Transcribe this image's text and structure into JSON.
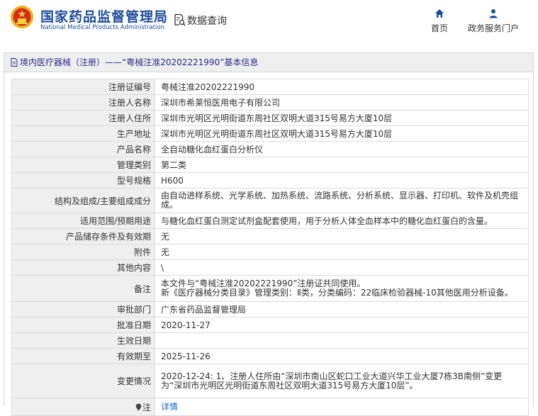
{
  "header": {
    "brand_cn": "国家药品监督管理局",
    "brand_en": "National Medical Products Administration",
    "search_label": "数据查询",
    "nav": [
      {
        "label": "首页",
        "icon": "home-icon"
      },
      {
        "label": "政务服务门户",
        "icon": "user-icon"
      }
    ]
  },
  "panel": {
    "title": "境内医疗器械（注册）——“粤械注准20202221990”基本信息"
  },
  "rows": [
    {
      "label": "注册证编号",
      "value": [
        "粤械注准20202221990"
      ]
    },
    {
      "label": "注册人名称",
      "value": [
        "深圳市希莱恒医用电子有限公司"
      ]
    },
    {
      "label": "注册人住所",
      "value": [
        "深圳市光明区光明街道东周社区双明大道315号易方大厦10层"
      ]
    },
    {
      "label": "生产地址",
      "value": [
        "深圳市光明区光明街道东周社区双明大道315号易方大厦10层"
      ]
    },
    {
      "label": "产品名称",
      "value": [
        "全自动糖化血红蛋白分析仪"
      ]
    },
    {
      "label": "管理类别",
      "value": [
        "第二类"
      ]
    },
    {
      "label": "型号规格",
      "value": [
        "H600"
      ]
    },
    {
      "label": "结构及组成/主要组成成分",
      "value": [
        "由自动进样系统、光学系统、加热系统、流路系统、分析系统、显示器、打印机、软件及机壳组",
        "成。"
      ]
    },
    {
      "label": "适用范围/预期用途",
      "value": [
        "与糖化血红蛋白测定试剂盒配套使用，用于分析人体全血样本中的糖化血红蛋白的含量。"
      ]
    },
    {
      "label": "产品储存条件及有效期",
      "value": [
        "无"
      ]
    },
    {
      "label": "附件",
      "value": [
        "无"
      ]
    },
    {
      "label": "其他内容",
      "value": [
        "\\"
      ]
    },
    {
      "label": "备注",
      "value": [
        "本文件与“粤械注准20202221990”注册证共同使用。",
        "新《医疗器械分类目录》管理类别：Ⅱ类，分类编码：22临床检验器械-10其他医用分析设备。"
      ]
    },
    {
      "label": "审批部门",
      "value": [
        "广东省药品监督管理局"
      ]
    },
    {
      "label": "批准日期",
      "value": [
        "2020-11-27"
      ]
    },
    {
      "label": "生效日期",
      "value": [
        ""
      ]
    },
    {
      "label": "有效期至",
      "value": [
        "2025-11-26"
      ]
    },
    {
      "label": "变更情况",
      "value": [
        "2020-12-24: 1、注册人住所由“深圳市南山区蛇口工业大道兴华工业大厦7栋3B南侧”变更",
        "为“深圳市光明区光明街道东周社区双明大道315号易方大厦10层”。"
      ]
    },
    {
      "label": "注",
      "value": [
        "详情"
      ],
      "link": true
    }
  ],
  "colors": {
    "brand": "#1f4d9c",
    "emblem_red": "#d62a1e",
    "emblem_gold": "#e8b21a",
    "link": "#1a66cc",
    "title_text": "#2b2b8a"
  }
}
